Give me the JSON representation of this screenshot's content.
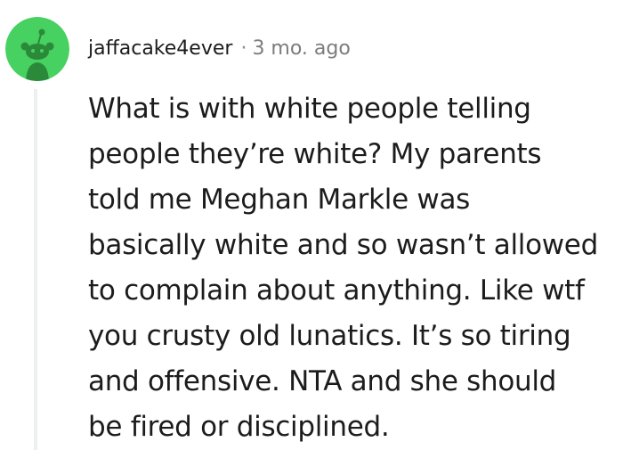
{
  "comment": {
    "author": "jaffacake4ever",
    "separator": "·",
    "timestamp": "3 mo. ago",
    "avatar_color": "#46d160",
    "body_lines": [
      "What is with white people telling",
      "people they’re white? My parents",
      "told me Meghan Markle was",
      "basically white and so wasn’t allowed",
      "to complain about anything. Like wtf",
      "you crusty old lunatics. It’s so tiring",
      "and offensive. NTA and she should",
      "be fired or disciplined."
    ]
  }
}
